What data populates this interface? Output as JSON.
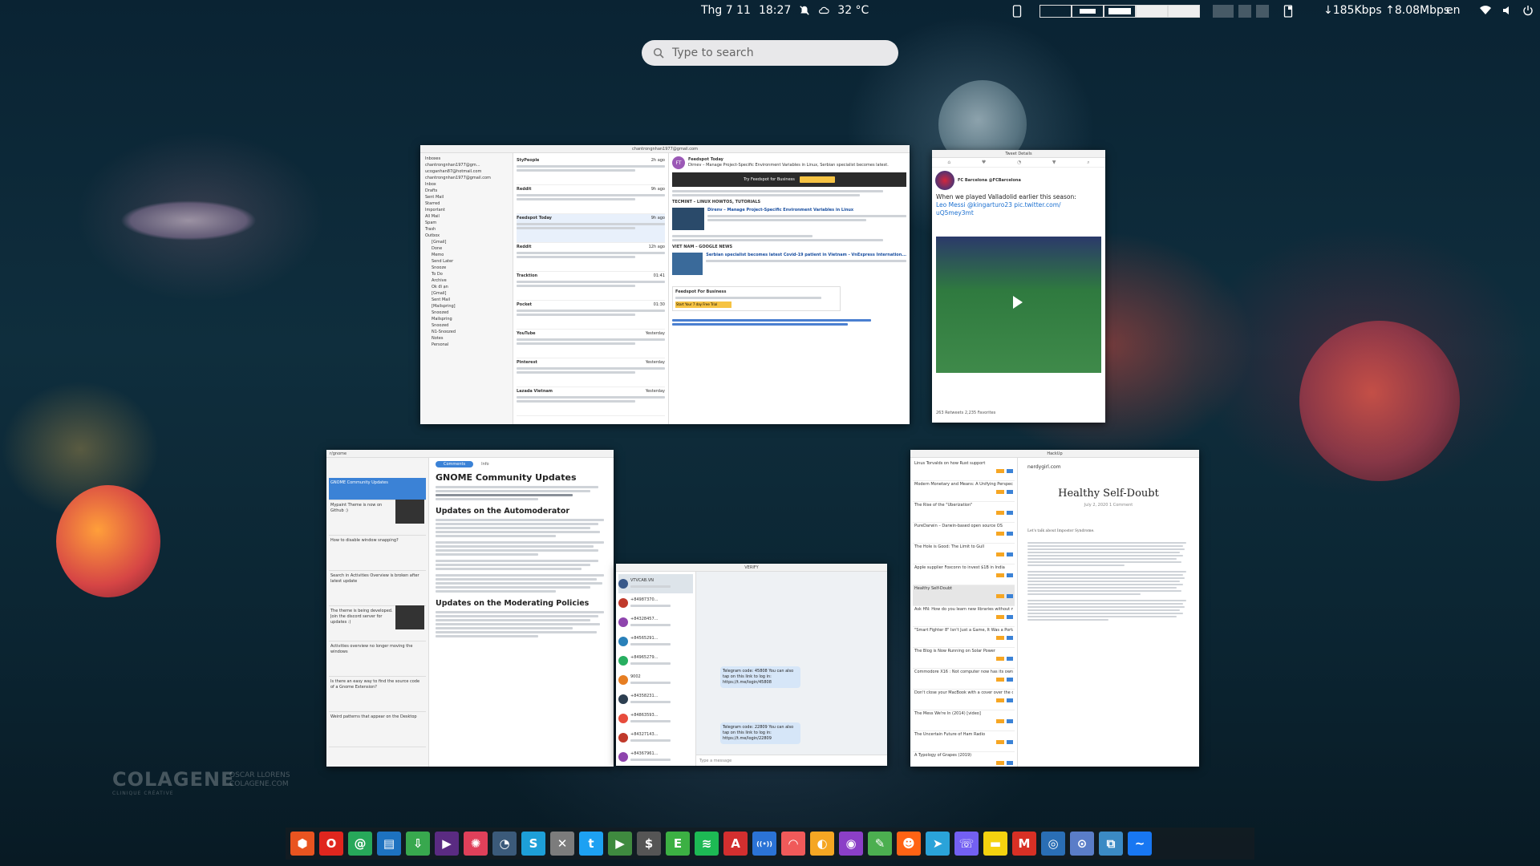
{
  "topbar": {
    "date": "Thg 7 11",
    "time": "18:27",
    "weather": "32 °C",
    "network": "↓185Kbps ↑8.08Mbps",
    "language": "en"
  },
  "search": {
    "placeholder": "Type to search"
  },
  "windows": {
    "mail": {
      "title": "chantrongnhan1977@gmail.com",
      "folders": [
        "Inboxes",
        "chantrongnhan1977@gm...",
        "ucoganhan87@hotmail.com",
        "chantrongnhan1977@gmail.com",
        "Inbox",
        "Drafts",
        "Sent Mail",
        "Starred",
        "Important",
        "All Mail",
        "Spam",
        "Trash",
        "Outbox",
        "[Gmail]",
        "Done",
        "Memo",
        "Send Later",
        "Snooze",
        "To Do",
        "Archive",
        "Ok đi ạn",
        "[Gmail]",
        "Sent Mail",
        "[Mailspring]",
        "Snoozed",
        "Mailspring",
        "Snoozed",
        "N1-Snoozed",
        "Notes",
        "Personal"
      ],
      "messages": [
        {
          "from": "StyPeople",
          "time": "2h ago"
        },
        {
          "from": "Reddit",
          "time": "9h ago"
        },
        {
          "from": "Feedspot Today",
          "time": "9h ago"
        },
        {
          "from": "Reddit",
          "time": "12h ago"
        },
        {
          "from": "Tracktion",
          "time": "01:41"
        },
        {
          "from": "Pocket",
          "time": "01:30"
        },
        {
          "from": "YouTube",
          "time": "Yesterday"
        },
        {
          "from": "Pinterest",
          "time": "Yesterday"
        },
        {
          "from": "Lazada Vietnam",
          "time": "Yesterday"
        }
      ],
      "reader": {
        "sender": "Feedspot Today",
        "subject": "Dirnev – Manage Project-Specific Environment Variables in Linux, Serbian specialist becomes latest...",
        "cta": "Try Feedspot for Business",
        "section1": "TECMINT – LINUX HOWTOS, TUTORIALS",
        "story1": "Direnv – Manage Project-Specific Environment Variables in Linux",
        "section2": "VIET NAM – GOOGLE NEWS",
        "story2": "Serbian specialist becomes latest Covid-19 patient in Vietnam - VnExpress Internation...",
        "business": "Feedspot For Business",
        "trial": "Start Your 7 day Free Trial"
      }
    },
    "tweet": {
      "title": "Tweet Details",
      "account": "FC Barcelona @FCBarcelona",
      "text": "When we played Valladolid earlier this season:",
      "mention": "Leo Messi @kingarturo23 pic.twitter.com/",
      "link": "uQ5mey3mt",
      "stats": "263 Retweets  2,235 Favorites"
    },
    "reddit": {
      "sub": "r/gnome",
      "tabs": [
        "Comments",
        "Info"
      ],
      "title": "GNOME Community Updates",
      "h2a": "Updates on the Automoderator",
      "h2b": "Updates on the Moderating Policies",
      "posts": [
        "GNOME Community Updates",
        "Mypaint Theme is now on Github :)",
        "How to disable window snapping?",
        "Search in Activities Overview is broken after latest update",
        "The theme is being developed. Join the discord server for updates :)",
        "Activities overview no longer moving the windows",
        "Is there an easy way to find the source code of a Gnome Extension?",
        "Weird patterns that appear on the Desktop"
      ]
    },
    "telegram": {
      "title": "VERIFY",
      "chats": [
        "VTVCAB.VN",
        "+84987370...",
        "+84328457...",
        "+84565291...",
        "+84965279...",
        "9002",
        "+84358231...",
        "+84863593...",
        "+84327143...",
        "+84367961..."
      ],
      "bubble1": "Telegram code: 45808 You can also tap on this link to log in: https://t.me/login/45808",
      "bubble2": "Telegram code: 22809 You can also tap on this link to log in: https://t.me/login/22809",
      "input": "Type a message"
    },
    "hn": {
      "title": "HackUp",
      "site": "nerdygirl.com",
      "post_title": "Healthy Self-Doubt",
      "meta": "July 2, 2020  1 Comment",
      "intro": "Let's talk about Impostor Syndrome.",
      "items": [
        "Linus Torvalds on how Rust support",
        "Modern Monetary and Means: A Unifying Perspective (2018)",
        "The Rise of the \"Uberization\"",
        "PureDarwin – Darwin-based open source OS",
        "The Hole is Good: The Limit to Gull",
        "Apple supplier Foxconn to invest $1B in India",
        "Healthy Self-Doubt",
        "Ask HN: How do you learn new libraries without much documentati...",
        "\"Smart Fighter 8\" Isn't Just a Game, It Was a Portal",
        "The Blog is Now Running on Solar Power",
        "Commodore X16 : Not computer now has its own website",
        "Don't close your MacBook with a cover over the camera",
        "The Mess We're In (2014) [video]",
        "The Uncertain Future of Ham Radio",
        "A Typology of Grapes (2019)"
      ]
    }
  },
  "watermark": {
    "brand": "COLAGENE",
    "tag": "CLINIQUE CRÉATIVE",
    "author": "OSCAR LLORENS",
    "site": "COLAGENE.COM"
  },
  "dock": {
    "apps": [
      {
        "name": "ubuntu-software",
        "color": "#e95420",
        "glyph": "⬢"
      },
      {
        "name": "opera",
        "color": "#e0261e",
        "glyph": "O"
      },
      {
        "name": "mail",
        "color": "#27a85a",
        "glyph": "@"
      },
      {
        "name": "files",
        "color": "#1d72c0",
        "glyph": "▤"
      },
      {
        "name": "downloader",
        "color": "#38a84e",
        "glyph": "⇩"
      },
      {
        "name": "video-player",
        "color": "#5a2b82",
        "glyph": "▶"
      },
      {
        "name": "aperture",
        "color": "#e0405a",
        "glyph": "✺"
      },
      {
        "name": "speedometer",
        "color": "#3b5a7a",
        "glyph": "◔"
      },
      {
        "name": "skype",
        "color": "#1d9fd8",
        "glyph": "S"
      },
      {
        "name": "tools",
        "color": "#7c7c7c",
        "glyph": "✕"
      },
      {
        "name": "twitter",
        "color": "#1da1f2",
        "glyph": "t"
      },
      {
        "name": "media-player",
        "color": "#3f8a3f",
        "glyph": "▶"
      },
      {
        "name": "money",
        "color": "#555555",
        "glyph": "$"
      },
      {
        "name": "evernote",
        "color": "#3cb043",
        "glyph": "E"
      },
      {
        "name": "spotify",
        "color": "#1db954",
        "glyph": "≋"
      },
      {
        "name": "pdf-reader",
        "color": "#d32f2f",
        "glyph": "A"
      },
      {
        "name": "podcast",
        "color": "#2b73d6",
        "glyph": "((•))"
      },
      {
        "name": "rss-reader",
        "color": "#f05a5a",
        "glyph": "◠"
      },
      {
        "name": "weather",
        "color": "#f5a623",
        "glyph": "◐"
      },
      {
        "name": "podcasts",
        "color": "#8b3fc7",
        "glyph": "◉"
      },
      {
        "name": "feather",
        "color": "#4caf50",
        "glyph": "✎"
      },
      {
        "name": "reddit",
        "color": "#ff6314",
        "glyph": "☻"
      },
      {
        "name": "telegram",
        "color": "#2aa3d9",
        "glyph": "➤"
      },
      {
        "name": "viber",
        "color": "#7360f2",
        "glyph": "☏"
      },
      {
        "name": "chat",
        "color": "#f5d20f",
        "glyph": "▬"
      },
      {
        "name": "gmail",
        "color": "#d93025",
        "glyph": "M"
      },
      {
        "name": "vpn",
        "color": "#2a6eb5",
        "glyph": "◎"
      },
      {
        "name": "toggle",
        "color": "#5a7dc8",
        "glyph": "⊙"
      },
      {
        "name": "clipboard",
        "color": "#3b8ac4",
        "glyph": "⧉"
      },
      {
        "name": "messenger",
        "color": "#1877f2",
        "glyph": "~"
      }
    ]
  }
}
